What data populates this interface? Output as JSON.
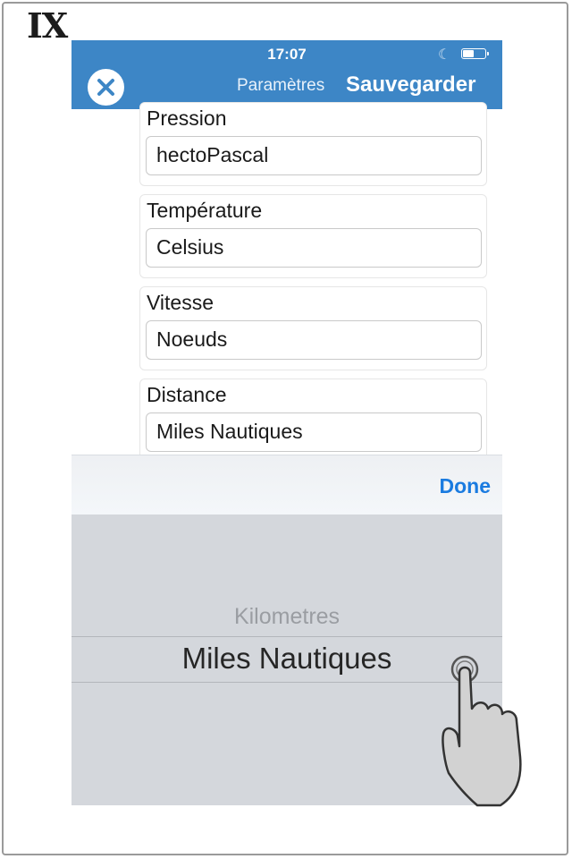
{
  "step_label": "IX",
  "status_bar": {
    "time": "17:07",
    "moon_icon": "moon-icon",
    "battery_icon": "battery-icon",
    "battery_level": 0.45
  },
  "nav": {
    "close_icon": "close-icon",
    "title": "Paramètres",
    "save_label": "Sauvegarder",
    "accent_color": "#3d86c6"
  },
  "settings": [
    {
      "label": "Pression",
      "value": "hectoPascal"
    },
    {
      "label": "Température",
      "value": "Celsius"
    },
    {
      "label": "Vitesse",
      "value": "Noeuds"
    },
    {
      "label": "Distance",
      "value": "Miles Nautiques"
    }
  ],
  "picker": {
    "done_label": "Done",
    "done_color": "#1a7be0",
    "options": [
      "Kilometres",
      "Miles Nautiques"
    ],
    "selected": "Miles Nautiques"
  },
  "pointer_icon": "hand-pointer-icon"
}
